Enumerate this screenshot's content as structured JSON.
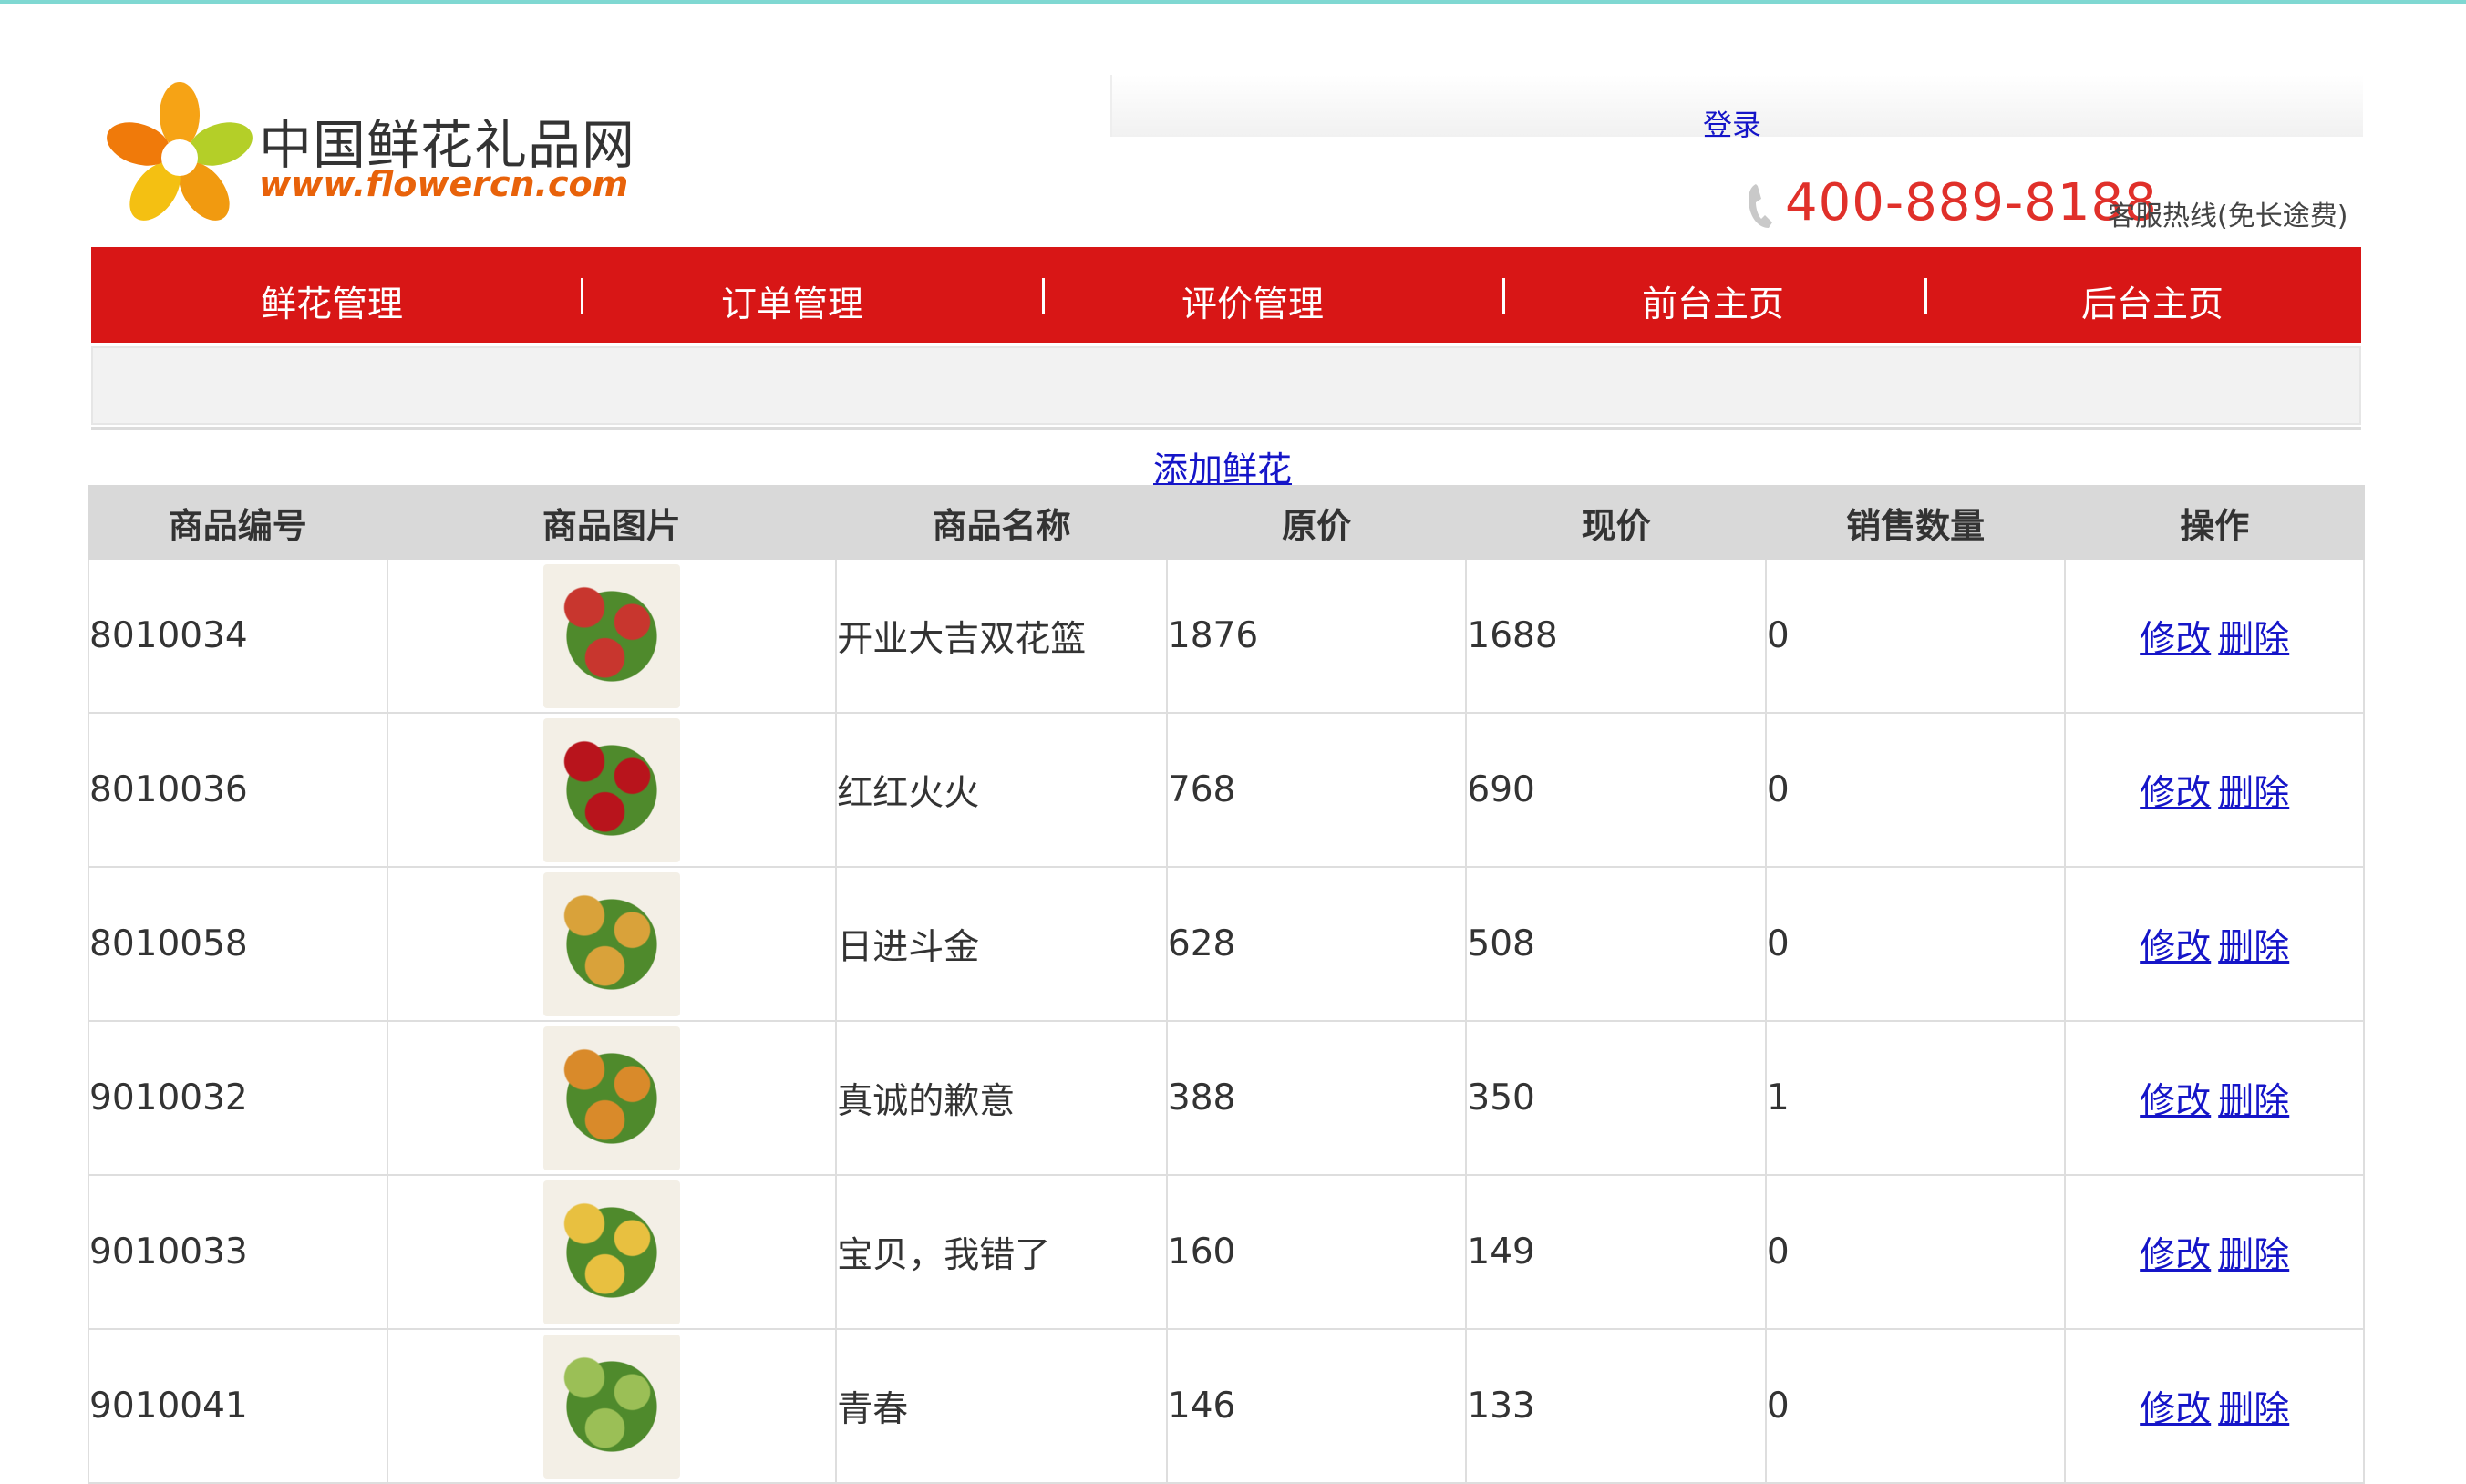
{
  "site": {
    "title": "中国鲜花礼品网",
    "url": "www.flowercn.com",
    "login": "登录",
    "hotline_number": "400-889-8188",
    "hotline_label": "客服热线(免长途费)"
  },
  "nav": {
    "items": [
      "鲜花管理",
      "订单管理",
      "评价管理",
      "前台主页",
      "后台主页"
    ]
  },
  "actions": {
    "add_flower": "添加鲜花"
  },
  "table": {
    "headers": [
      "商品编号",
      "商品图片",
      "商品名称",
      "原价",
      "现价",
      "销售数量",
      "操作"
    ],
    "edit_label": "修改",
    "delete_label": "删除",
    "rows": [
      {
        "id": "8010034",
        "name": "开业大吉双花篮",
        "orig": "1876",
        "now": "1688",
        "sold": "0",
        "img_color": "#c8362e"
      },
      {
        "id": "8010036",
        "name": "红红火火",
        "orig": "768",
        "now": "690",
        "sold": "0",
        "img_color": "#b8141c"
      },
      {
        "id": "8010058",
        "name": "日进斗金",
        "orig": "628",
        "now": "508",
        "sold": "0",
        "img_color": "#d9a23a"
      },
      {
        "id": "9010032",
        "name": "真诚的歉意",
        "orig": "388",
        "now": "350",
        "sold": "1",
        "img_color": "#d98a2a"
      },
      {
        "id": "9010033",
        "name": "宝贝，我错了",
        "orig": "160",
        "now": "149",
        "sold": "0",
        "img_color": "#e8c040"
      },
      {
        "id": "9010041",
        "name": "青春",
        "orig": "146",
        "now": "133",
        "sold": "0",
        "img_color": "#9bbf56"
      }
    ]
  },
  "colors": {
    "nav_red": "#d81616",
    "link_blue": "#1515c8",
    "phone_red": "#e0302a"
  }
}
